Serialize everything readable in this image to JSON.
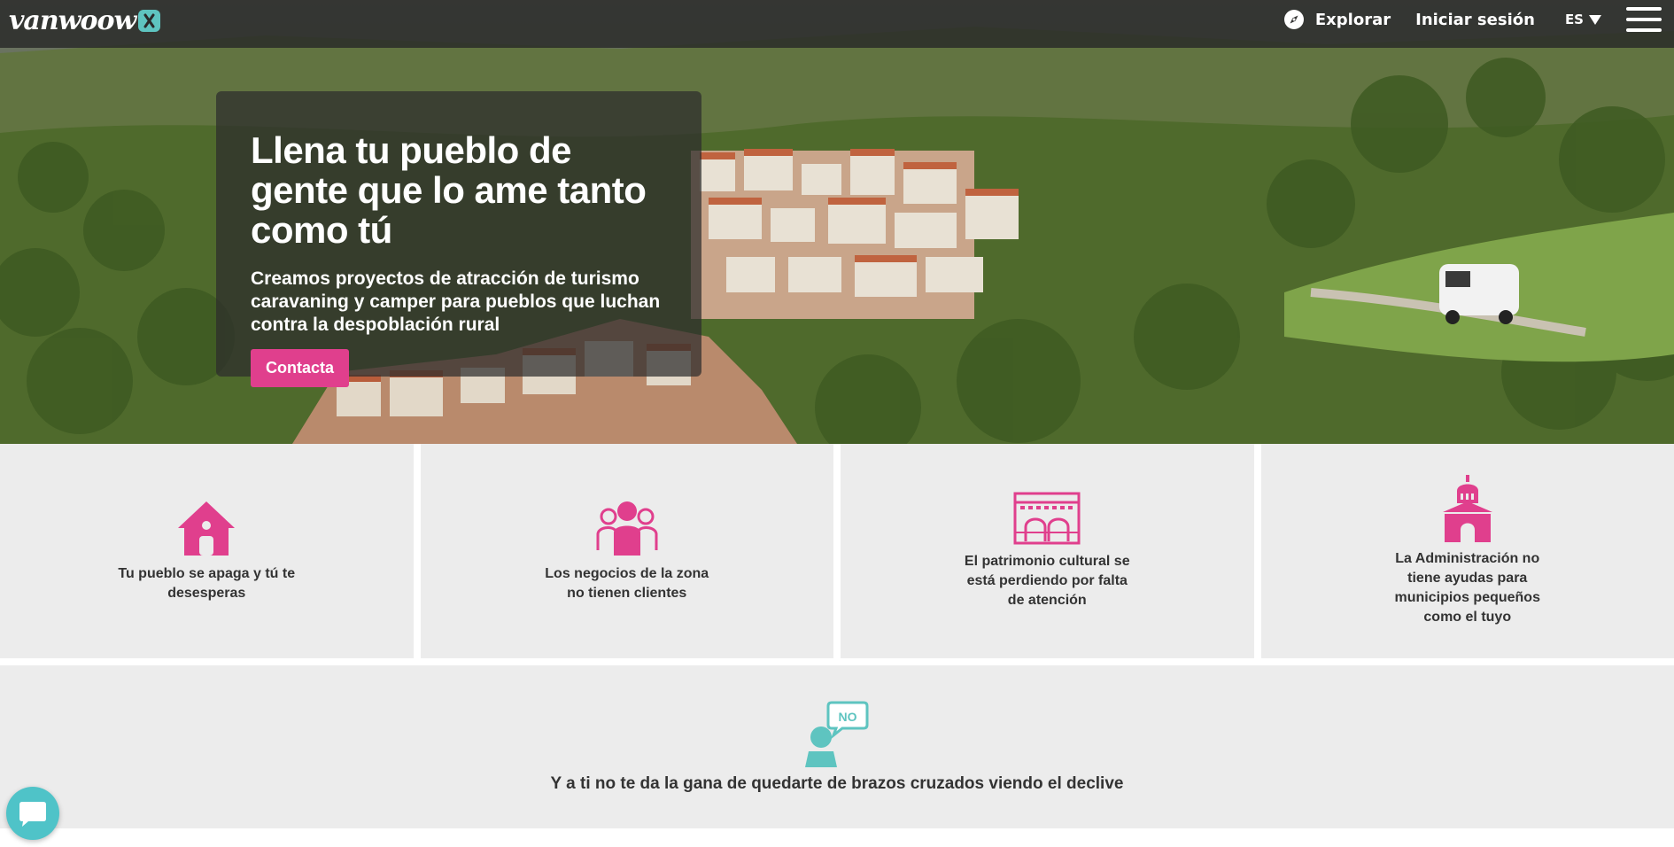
{
  "brand": {
    "logo_text": "vanwoow",
    "accent": "#e03f8d",
    "teal": "#5ec4c0"
  },
  "nav": {
    "explore_label": "Explorar",
    "explore_icon": "compass-icon",
    "login_label": "Iniciar sesión",
    "language": "ES",
    "menu_icon": "hamburger-icon"
  },
  "hero": {
    "title": "Llena tu pueblo de gente que lo ame tanto como tú",
    "subtitle": "Creamos proyectos de atracción de turismo caravaning y camper para pueblos que luchan contra la despoblación rural",
    "cta_label": "Contacta"
  },
  "features": [
    {
      "icon": "house-icon",
      "text": "Tu pueblo se apaga y tú te desesperas"
    },
    {
      "icon": "people-icon",
      "text": "Los negocios de la zona no tienen clientes"
    },
    {
      "icon": "heritage-building-icon",
      "text": "El patrimonio cultural se está perdiendo por falta de atención"
    },
    {
      "icon": "town-hall-icon",
      "text": "La Administración no tiene ayudas para municipios pequeños como el tuyo"
    }
  ],
  "bottom": {
    "icon": "person-no-speech-icon",
    "speech_text": "NO",
    "text": "Y a ti no te da la gana de quedarte de brazos cruzados viendo el declive"
  },
  "chat": {
    "icon": "chat-bubble-icon"
  }
}
